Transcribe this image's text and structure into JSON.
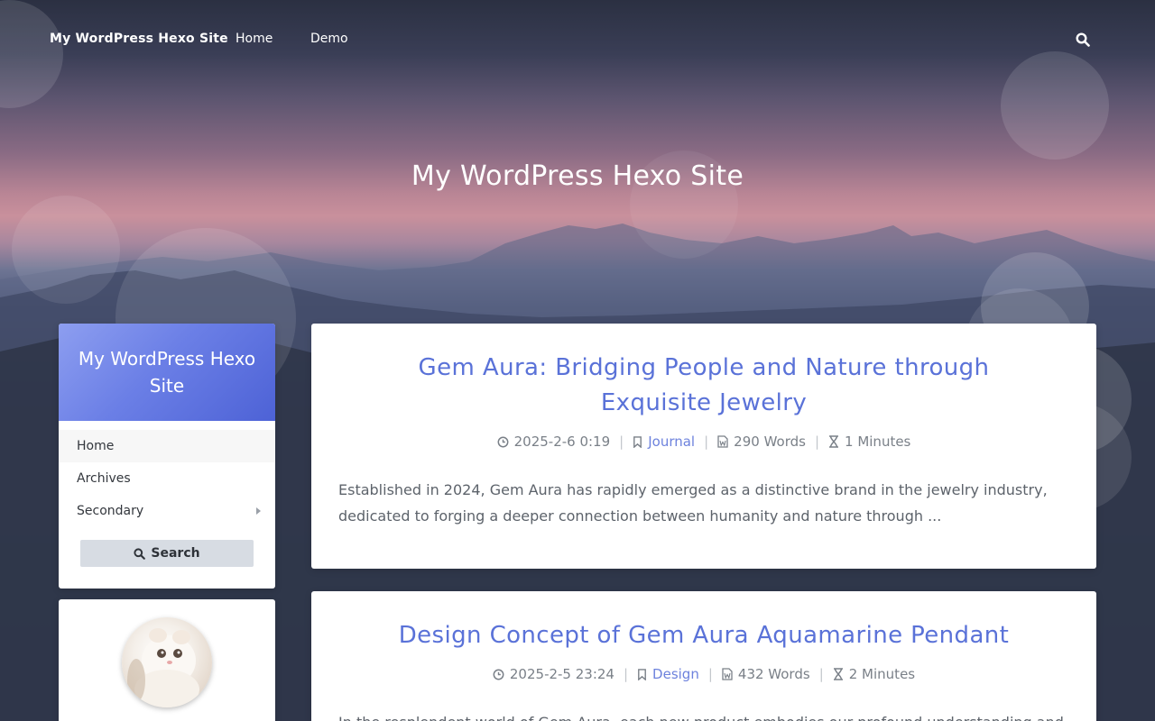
{
  "navbar": {
    "brand": "My WordPress Hexo Site",
    "links": [
      "Home",
      "Demo"
    ],
    "search_icon": "search-icon"
  },
  "hero": {
    "title": "My WordPress Hexo Site"
  },
  "sidebar": {
    "title": "My WordPress Hexo Site",
    "menu": [
      {
        "label": "Home",
        "active": true
      },
      {
        "label": "Archives",
        "active": false
      },
      {
        "label": "Secondary",
        "active": false,
        "has_submenu": true
      }
    ],
    "search_label": "Search",
    "search_icon": "search-icon",
    "avatar": "cat-avatar"
  },
  "posts": [
    {
      "title": "Gem Aura: Bridging People and Nature through Exquisite Jewelry",
      "date": "2025-2-6 0:19",
      "category": "Journal",
      "words": "290 Words",
      "time": "1 Minutes",
      "excerpt": "Established in 2024, Gem Aura has rapidly emerged as a distinctive brand in the jewelry industry, dedicated to forging a deeper connection between humanity and nature through ..."
    },
    {
      "title": "Design Concept of Gem Aura Aquamarine Pendant",
      "date": "2025-2-5 23:24",
      "category": "Design",
      "words": "432 Words",
      "time": "2 Minutes",
      "excerpt": "In the resplendent world of Gem Aura, each new product embodies our profound understanding and"
    }
  ],
  "colors": {
    "accent": "#5a72d8",
    "category_link": "#6d82dd",
    "sidebar_header_start": "#8d9ef0",
    "sidebar_header_end": "#4d62d6"
  }
}
